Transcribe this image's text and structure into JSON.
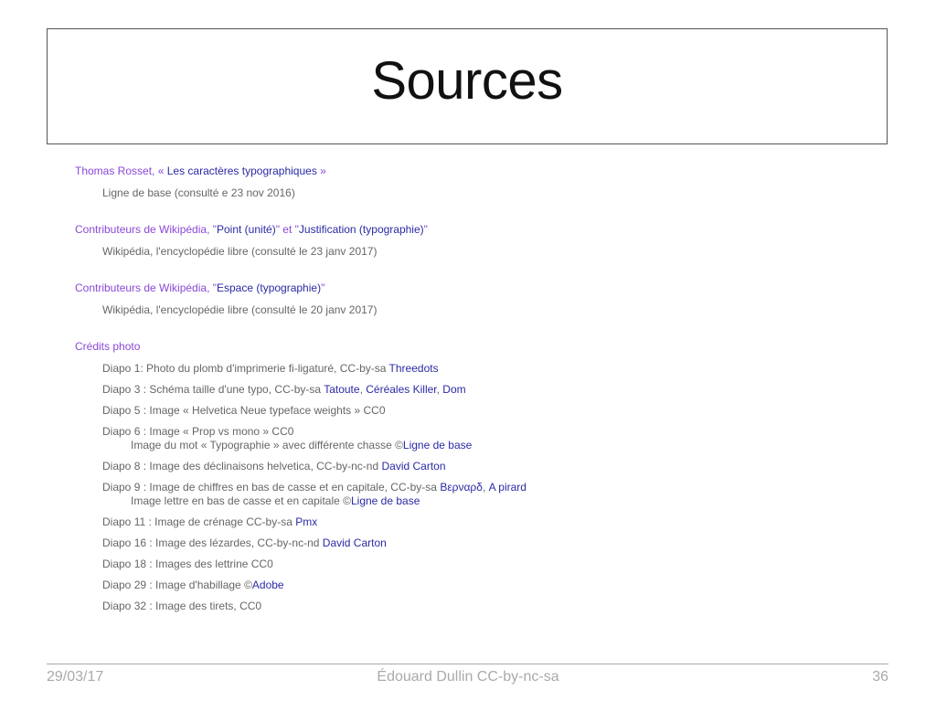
{
  "title": "Sources",
  "sections": [
    {
      "heading_parts": [
        {
          "text": "Thomas Rosset, « ",
          "link": false
        },
        {
          "text": "Les caractères typographiques",
          "link": true
        },
        {
          "text": " »",
          "link": false
        }
      ],
      "detail": "Ligne de base (consulté e 23 nov 2016)"
    },
    {
      "heading_parts": [
        {
          "text": "Contributeurs de Wikipédia, \"",
          "link": false
        },
        {
          "text": "Point (unité)",
          "link": true
        },
        {
          "text": "\" et \"",
          "link": false
        },
        {
          "text": "Justification (typographie)",
          "link": true
        },
        {
          "text": "\"",
          "link": false
        }
      ],
      "detail": "Wikipédia, l'encyclopédie libre (consulté le 23 janv 2017)"
    },
    {
      "heading_parts": [
        {
          "text": "Contributeurs de Wikipédia, \"",
          "link": false
        },
        {
          "text": "Espace (typographie)",
          "link": true
        },
        {
          "text": "\"",
          "link": false
        }
      ],
      "detail": "Wikipédia, l'encyclopédie libre (consulté le 20 janv 2017)"
    }
  ],
  "credits": {
    "heading": "Crédits photo",
    "items": [
      {
        "lines": [
          [
            {
              "text": "Diapo 1: Photo du plomb d'imprimerie fi-ligaturé, CC-by-sa ",
              "link": false
            },
            {
              "text": "Threedots",
              "link": true
            }
          ]
        ]
      },
      {
        "lines": [
          [
            {
              "text": "Diapo 3 : Schéma taille d'une typo, CC-by-sa ",
              "link": false
            },
            {
              "text": "Tatoute",
              "link": true
            },
            {
              "text": ", ",
              "link": false
            },
            {
              "text": "Céréales Killer",
              "link": true
            },
            {
              "text": ", ",
              "link": false
            },
            {
              "text": "Dom",
              "link": true
            }
          ]
        ]
      },
      {
        "lines": [
          [
            {
              "text": "Diapo 5 : Image « Helvetica Neue typeface weights » CC0",
              "link": false
            }
          ]
        ]
      },
      {
        "lines": [
          [
            {
              "text": "Diapo 6 : Image « Prop vs mono » CC0",
              "link": false
            }
          ],
          [
            {
              "text": "Image du mot « Typographie » avec différente chasse ©",
              "link": false
            },
            {
              "text": "Ligne de base",
              "link": true
            }
          ]
        ]
      },
      {
        "lines": [
          [
            {
              "text": "Diapo 8 : Image des déclinaisons helvetica, CC-by-nc-nd ",
              "link": false
            },
            {
              "text": "David Carton",
              "link": true
            }
          ]
        ]
      },
      {
        "lines": [
          [
            {
              "text": "Diapo  9 : Image de chiffres en bas de casse et en capitale, CC-by-sa ",
              "link": false
            },
            {
              "text": "Βερναρδ",
              "link": true
            },
            {
              "text": ", ",
              "link": false
            },
            {
              "text": "A pirard",
              "link": true
            }
          ],
          [
            {
              "text": "Image lettre en bas de casse et en capitale ©",
              "link": false
            },
            {
              "text": "Ligne de base",
              "link": true
            }
          ]
        ]
      },
      {
        "lines": [
          [
            {
              "text": "Diapo 11 : Image de crénage CC-by-sa ",
              "link": false
            },
            {
              "text": "Pmx",
              "link": true
            }
          ]
        ]
      },
      {
        "lines": [
          [
            {
              "text": "Diapo 16 : Image des lézardes, CC-by-nc-nd ",
              "link": false
            },
            {
              "text": "David Carton",
              "link": true
            }
          ]
        ]
      },
      {
        "lines": [
          [
            {
              "text": "Diapo 18 : Images des lettrine CC0",
              "link": false
            }
          ]
        ]
      },
      {
        "lines": [
          [
            {
              "text": "Diapo 29 : Image d'habillage ©",
              "link": false
            },
            {
              "text": "Adobe",
              "link": true
            }
          ]
        ]
      },
      {
        "lines": [
          [
            {
              "text": "Diapo 32 : Image des tirets, CC0",
              "link": false
            }
          ]
        ]
      }
    ]
  },
  "footer": {
    "date": "29/03/17",
    "author": "Édouard Dullin CC-by-nc-sa",
    "page": "36"
  }
}
